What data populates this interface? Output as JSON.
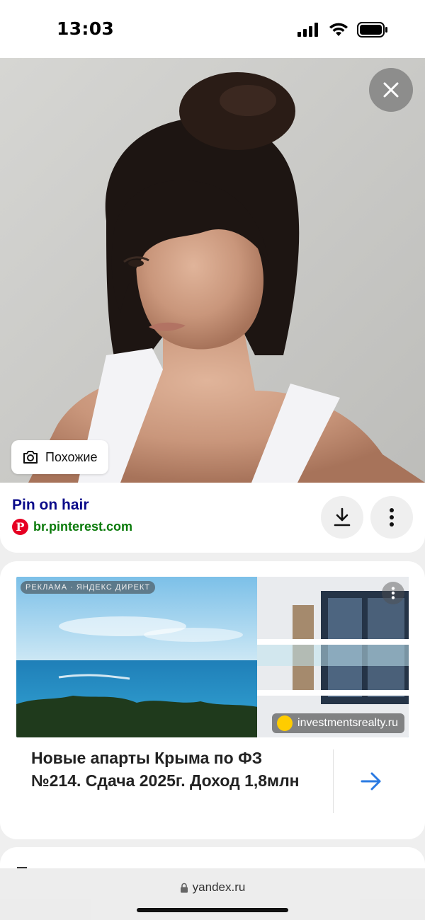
{
  "status_bar": {
    "time": "13:03",
    "icons": [
      "signal-icon",
      "wifi-icon",
      "battery-icon"
    ]
  },
  "viewer": {
    "close_icon": "close-icon",
    "similar_button": {
      "label": "Похожие",
      "icon": "camera-search-icon"
    }
  },
  "result": {
    "title": "Pin on hair",
    "source_domain": "br.pinterest.com",
    "source_logo_letter": "P",
    "actions": [
      "download-icon",
      "more-vertical-icon"
    ]
  },
  "ad": {
    "tag": "РЕКЛАМА · ЯНДЕКС ДИРЕКТ",
    "domain": "investmentsrealty.ru",
    "headline": "Новые апарты Крыма по ФЗ №214. Сдача 2025г. Доход 1,8млн",
    "arrow_icon": "arrow-right-icon"
  },
  "browser": {
    "url": "yandex.ru",
    "lock_icon": "lock-icon"
  },
  "colors": {
    "result_title": "#0b0b8a",
    "source_domain": "#0a7a0a",
    "pinterest": "#e60023",
    "ad_arrow": "#2a7ae2",
    "ad_domain_dot": "#ffcc00"
  }
}
